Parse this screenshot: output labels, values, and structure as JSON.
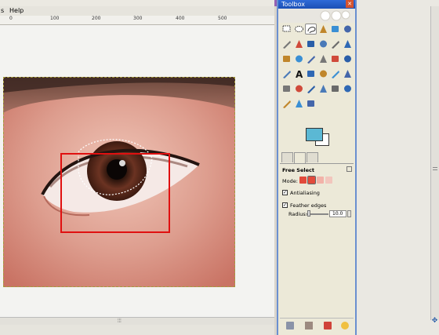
{
  "menubar": {
    "items": [
      "s",
      "Help"
    ]
  },
  "ruler": {
    "ticks": [
      "0",
      "100",
      "200",
      "300",
      "400",
      "500"
    ]
  },
  "toolbox": {
    "title": "Toolbox",
    "tools": [
      "rect-select",
      "ellipse-select",
      "free-select",
      "fuzzy-select",
      "scissors-select",
      "foreground-select",
      "paths",
      "color-picker",
      "zoom",
      "measure",
      "move",
      "align",
      "crop",
      "rotate",
      "scale",
      "shear",
      "perspective",
      "flip",
      "cage-transform",
      "text",
      "bucket-fill",
      "blend",
      "pencil",
      "paintbrush",
      "eraser",
      "airbrush",
      "ink",
      "clone",
      "heal",
      "perspective-clone",
      "blur",
      "smudge",
      "dodge-burn"
    ],
    "active_tool": "free-select",
    "colors": {
      "foreground": "#5bb8d4",
      "background": "#ffffff"
    }
  },
  "tool_options": {
    "title": "Free Select",
    "mode_label": "Mode:",
    "antialiasing_label": "Antialiasing",
    "antialiasing_checked": true,
    "feather_label": "Feather edges",
    "feather_checked": true,
    "radius_label": "Radius:",
    "radius_value": "10.0"
  },
  "canvas": {
    "selection_box_color": "#e01010"
  }
}
